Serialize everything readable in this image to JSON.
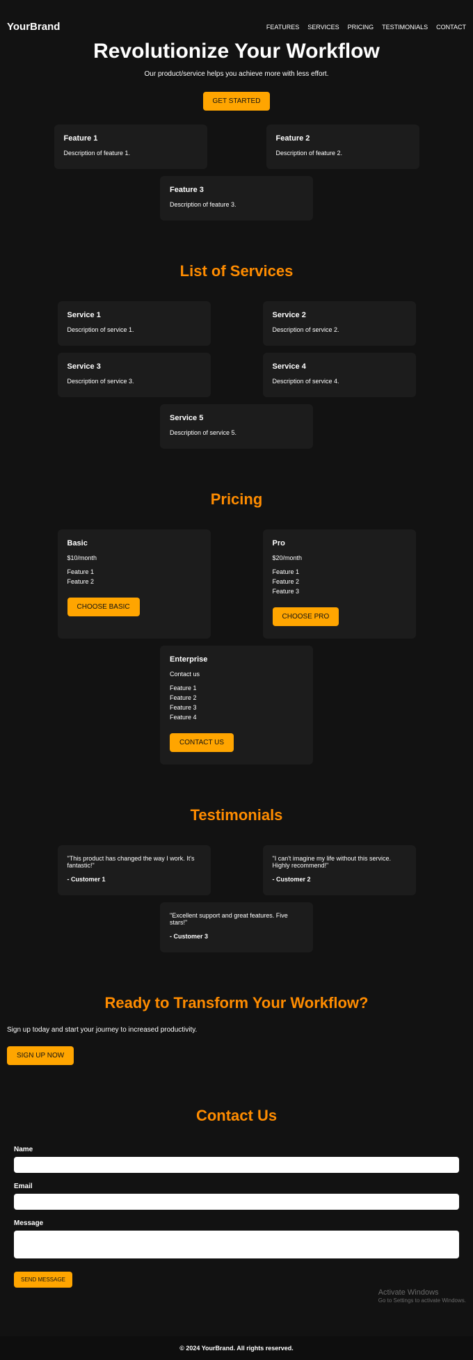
{
  "brand": "YourBrand",
  "nav": [
    "FEATURES",
    "SERVICES",
    "PRICING",
    "TESTIMONIALS",
    "CONTACT"
  ],
  "hero": {
    "title": "Revolutionize Your Workflow",
    "subtitle": "Our product/service helps you achieve more with less effort.",
    "cta": "GET STARTED"
  },
  "features": [
    {
      "title": "Feature 1",
      "desc": "Description of feature 1."
    },
    {
      "title": "Feature 2",
      "desc": "Description of feature 2."
    },
    {
      "title": "Feature 3",
      "desc": "Description of feature 3."
    }
  ],
  "services": {
    "heading": "List of Services",
    "items": [
      {
        "title": "Service 1",
        "desc": "Description of service 1."
      },
      {
        "title": "Service 2",
        "desc": "Description of service 2."
      },
      {
        "title": "Service 3",
        "desc": "Description of service 3."
      },
      {
        "title": "Service 4",
        "desc": "Description of service 4."
      },
      {
        "title": "Service 5",
        "desc": "Description of service 5."
      }
    ]
  },
  "pricing": {
    "heading": "Pricing",
    "plans": [
      {
        "name": "Basic",
        "price": "$10/month",
        "features": [
          "Feature 1",
          "Feature 2"
        ],
        "cta": "CHOOSE BASIC"
      },
      {
        "name": "Pro",
        "price": "$20/month",
        "features": [
          "Feature 1",
          "Feature 2",
          "Feature 3"
        ],
        "cta": "CHOOSE PRO"
      },
      {
        "name": "Enterprise",
        "price": "Contact us",
        "features": [
          "Feature 1",
          "Feature 2",
          "Feature 3",
          "Feature 4"
        ],
        "cta": "CONTACT US"
      }
    ]
  },
  "testimonials": {
    "heading": "Testimonials",
    "items": [
      {
        "quote": "\"This product has changed the way I work. It's fantastic!\"",
        "author": "- Customer 1"
      },
      {
        "quote": "\"I can't imagine my life without this service. Highly recommend!\"",
        "author": "- Customer 2"
      },
      {
        "quote": "\"Excellent support and great features. Five stars!\"",
        "author": "- Customer 3"
      }
    ]
  },
  "cta": {
    "heading": "Ready to Transform Your Workflow?",
    "text": "Sign up today and start your journey to increased productivity.",
    "button": "SIGN UP NOW"
  },
  "contact": {
    "heading": "Contact Us",
    "name_label": "Name",
    "email_label": "Email",
    "message_label": "Message",
    "submit": "SEND MESSAGE"
  },
  "footer": "© 2024 YourBrand. All rights reserved.",
  "watermark": {
    "line1": "Activate Windows",
    "line2": "Go to Settings to activate Windows."
  }
}
